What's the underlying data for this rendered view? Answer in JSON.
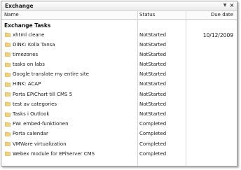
{
  "window": {
    "title": "Exchange"
  },
  "columns": {
    "name": "Name",
    "status": "Status",
    "due_date": "Due date"
  },
  "group": {
    "label": "Exchange Tasks"
  },
  "tasks": [
    {
      "subject": "xhtml cleane",
      "status": "NotStarted",
      "due": "10/12/2009"
    },
    {
      "subject": "DINK: Kolla Tansa",
      "status": "NotStarted",
      "due": ""
    },
    {
      "subject": "timezones",
      "status": "NotStarted",
      "due": ""
    },
    {
      "subject": "tasks on labs",
      "status": "NotStarted",
      "due": ""
    },
    {
      "subject": "Google translate my entire site",
      "status": "NotStarted",
      "due": ""
    },
    {
      "subject": "HINK: ACAP",
      "status": "NotStarted",
      "due": ""
    },
    {
      "subject": "Porta EPiChart till CMS 5",
      "status": "NotStarted",
      "due": ""
    },
    {
      "subject": "test av categories",
      "status": "NotStarted",
      "due": ""
    },
    {
      "subject": "Tasks i Outlook",
      "status": "NotStarted",
      "due": ""
    },
    {
      "subject": "FW: embed-funktionen",
      "status": "Completed",
      "due": ""
    },
    {
      "subject": "Porta calendar",
      "status": "Completed",
      "due": ""
    },
    {
      "subject": "VMWare virtualization",
      "status": "Completed",
      "due": ""
    },
    {
      "subject": "Webex module for EPiServer CMS",
      "status": "Completed",
      "due": ""
    }
  ],
  "icons": {
    "row_icon": "folder-icon",
    "pin": "pin-icon",
    "close": "close-icon"
  },
  "colors": {
    "folder_fill": "#f2d37a",
    "folder_stroke": "#c9a53f",
    "border": "#9a9a9a"
  }
}
